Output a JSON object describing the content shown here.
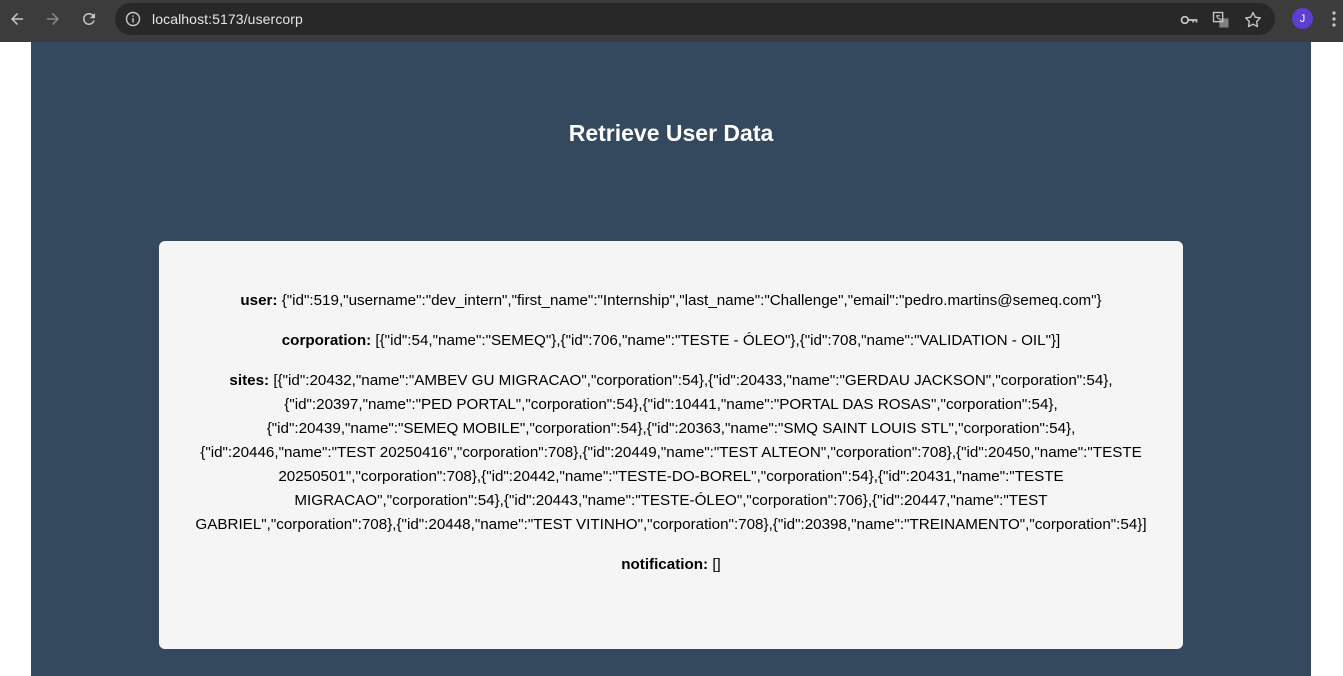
{
  "browser": {
    "url": "localhost:5173/usercorp",
    "avatar_letter": "J"
  },
  "page": {
    "title": "Retrieve User Data",
    "fields": {
      "user_label": "user:",
      "user_value": "{\"id\":519,\"username\":\"dev_intern\",\"first_name\":\"Internship\",\"last_name\":\"Challenge\",\"email\":\"pedro.martins@semeq.com\"}",
      "corporation_label": "corporation:",
      "corporation_value": "[{\"id\":54,\"name\":\"SEMEQ\"},{\"id\":706,\"name\":\"TESTE - ÓLEO\"},{\"id\":708,\"name\":\"VALIDATION - OIL\"}]",
      "sites_label": "sites:",
      "sites_value": "[{\"id\":20432,\"name\":\"AMBEV GU MIGRACAO\",\"corporation\":54},{\"id\":20433,\"name\":\"GERDAU JACKSON\",\"corporation\":54},{\"id\":20397,\"name\":\"PED PORTAL\",\"corporation\":54},{\"id\":10441,\"name\":\"PORTAL DAS ROSAS\",\"corporation\":54},{\"id\":20439,\"name\":\"SEMEQ MOBILE\",\"corporation\":54},{\"id\":20363,\"name\":\"SMQ SAINT LOUIS STL\",\"corporation\":54},{\"id\":20446,\"name\":\"TEST 20250416\",\"corporation\":708},{\"id\":20449,\"name\":\"TEST ALTEON\",\"corporation\":708},{\"id\":20450,\"name\":\"TESTE 20250501\",\"corporation\":708},{\"id\":20442,\"name\":\"TESTE-DO-BOREL\",\"corporation\":54},{\"id\":20431,\"name\":\"TESTE MIGRACAO\",\"corporation\":54},{\"id\":20443,\"name\":\"TESTE-ÓLEO\",\"corporation\":706},{\"id\":20447,\"name\":\"TEST GABRIEL\",\"corporation\":708},{\"id\":20448,\"name\":\"TEST VITINHO\",\"corporation\":708},{\"id\":20398,\"name\":\"TREINAMENTO\",\"corporation\":54}]",
      "notification_label": "notification:",
      "notification_value": "[]"
    }
  },
  "colors": {
    "page_background": "#34495e",
    "card_background": "#f5f5f5",
    "browser_bar": "#3c3c3c",
    "avatar": "#5c3fd0"
  }
}
